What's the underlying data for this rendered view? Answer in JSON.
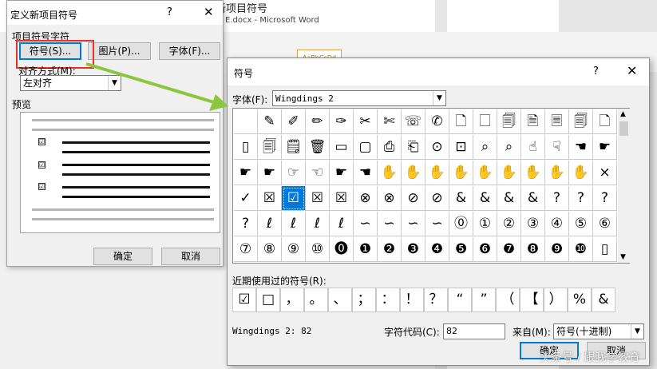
{
  "background": {
    "doc_title": "新项目符号",
    "doc_subtitle": "E.docx - Microsoft Word",
    "style_preview": "AaBbCcDd"
  },
  "dialog1": {
    "title": "定义新项目符号",
    "help": "?",
    "close": "✕",
    "group_label": "项目符号字符",
    "symbol_button": "符号(S)...",
    "picture_button": "图片(P)...",
    "font_button": "字体(F)...",
    "align_label": "对齐方式(M):",
    "align_value": "左对齐",
    "preview_label": "预览",
    "preview_check": "☑",
    "ok": "确定",
    "cancel": "取消"
  },
  "dialog2": {
    "title": "符号",
    "help": "?",
    "close": "✕",
    "font_label": "字体(F):",
    "font_value": "Wingdings 2",
    "symbols": [
      [
        "",
        "✎",
        "✐",
        "✏",
        "✑",
        "✂",
        "✄",
        "☏",
        "✆",
        "🗋",
        "🗌",
        "🗐",
        "🗎",
        "🗏",
        "🗐",
        "🗋"
      ],
      [
        "▯",
        "🗐",
        "🗒",
        "🗑",
        "▭",
        "▢",
        "⎙",
        "⎗",
        "⊙",
        "⊡",
        "⌕",
        "⌕",
        "☝",
        "☟",
        "☚",
        "☛"
      ],
      [
        "☛",
        "☛",
        "☞",
        "☜",
        "☛",
        "☚",
        "✋",
        "✋",
        "✋",
        "✋",
        "✋",
        "✋",
        "✋",
        "✋",
        "✋",
        "×"
      ],
      [
        "✓",
        "☒",
        "☑",
        "☒",
        "☒",
        "⊗",
        "⊗",
        "⊘",
        "⊘",
        "&",
        "&",
        "&",
        "&",
        "?",
        "?",
        "?"
      ],
      [
        "?",
        "ℓ",
        "ℓ",
        "ℓ",
        "ℓ",
        "∽",
        "∽",
        "∽",
        "∽",
        "⓪",
        "①",
        "②",
        "③",
        "④",
        "⑤",
        "⑥"
      ],
      [
        "⑦",
        "⑧",
        "⑨",
        "⑩",
        "⓿",
        "❶",
        "❷",
        "❸",
        "❹",
        "❺",
        "❻",
        "❼",
        "❽",
        "❾",
        "❿",
        "▯"
      ]
    ],
    "selected": "☑",
    "recent_label": "近期使用过的符号(R):",
    "recent": [
      "☑",
      "□",
      "，",
      "。",
      "、",
      "；",
      "：",
      "！",
      "？",
      "“",
      "”",
      "（",
      "【",
      "）",
      "%",
      "&"
    ],
    "font_code": "Wingdings 2: 82",
    "code_label": "字符代码(C):",
    "code_value": "82",
    "from_label": "来自(M):",
    "from_value": "符号(十进制)",
    "ok": "确定",
    "cancel": "取消"
  },
  "watermark": "头条号 / 跟我学教育",
  "colors": {
    "highlight_red": "#e8312a",
    "arrow_green": "#8cc63f",
    "selection_blue": "#0078d7"
  }
}
